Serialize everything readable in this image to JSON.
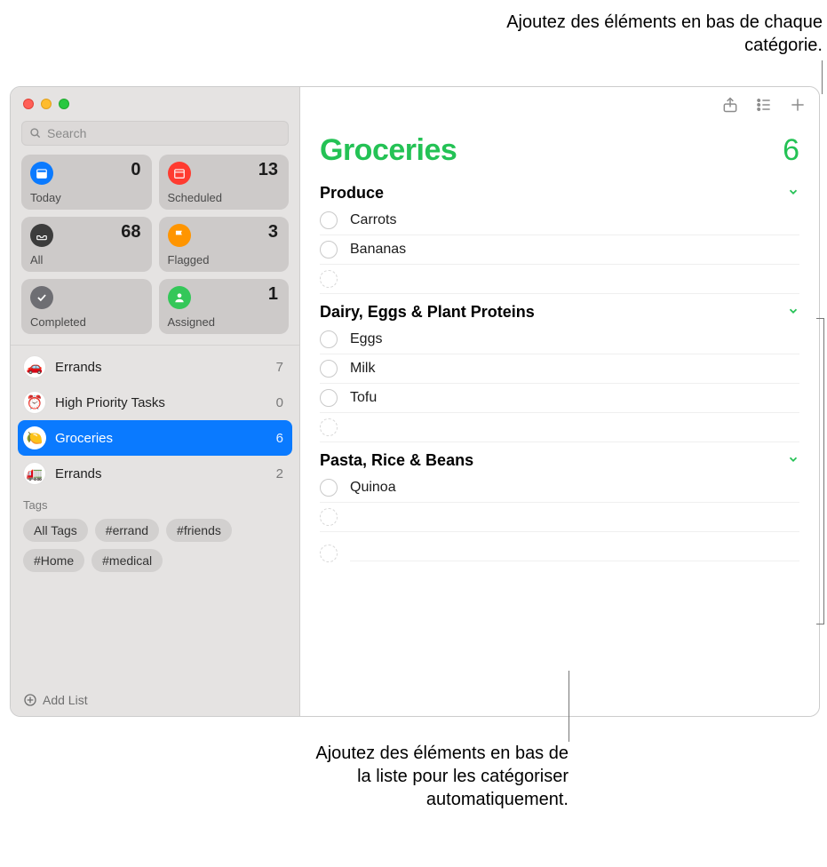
{
  "callouts": {
    "top": "Ajoutez des éléments en bas de chaque catégorie.",
    "bottom": "Ajoutez des éléments en bas de la liste pour les catégoriser automatiquement."
  },
  "search": {
    "placeholder": "Search"
  },
  "smart": {
    "today": {
      "label": "Today",
      "count": "0"
    },
    "scheduled": {
      "label": "Scheduled",
      "count": "13"
    },
    "all": {
      "label": "All",
      "count": "68"
    },
    "flagged": {
      "label": "Flagged",
      "count": "3"
    },
    "completed": {
      "label": "Completed",
      "count": ""
    },
    "assigned": {
      "label": "Assigned",
      "count": "1"
    }
  },
  "lists": [
    {
      "emoji": "🚗",
      "name": "Errands",
      "count": "7",
      "selected": false
    },
    {
      "emoji": "⏰",
      "name": "High Priority Tasks",
      "count": "0",
      "selected": false
    },
    {
      "emoji": "🍋",
      "name": "Groceries",
      "count": "6",
      "selected": true
    },
    {
      "emoji": "🚛",
      "name": "Errands",
      "count": "2",
      "selected": false
    }
  ],
  "tags": {
    "title": "Tags",
    "items": [
      "All Tags",
      "#errand",
      "#friends",
      "#Home",
      "#medical"
    ]
  },
  "addList": "Add List",
  "main": {
    "title": "Groceries",
    "count": "6",
    "sections": [
      {
        "name": "Produce",
        "items": [
          "Carrots",
          "Bananas"
        ]
      },
      {
        "name": "Dairy, Eggs & Plant Proteins",
        "items": [
          "Eggs",
          "Milk",
          "Tofu"
        ]
      },
      {
        "name": "Pasta, Rice & Beans",
        "items": [
          "Quinoa"
        ]
      }
    ]
  }
}
